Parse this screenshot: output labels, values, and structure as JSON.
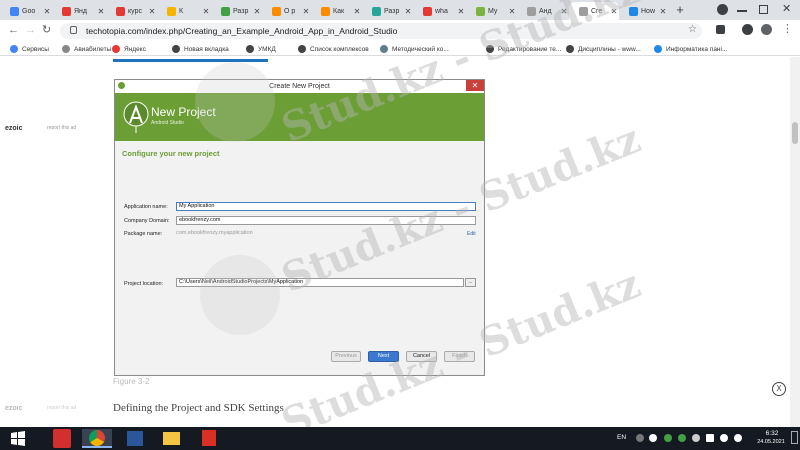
{
  "tabs": [
    {
      "label": "Goo",
      "color": "#4285f4",
      "icon": "docs-icon",
      "active": false
    },
    {
      "label": "Янд",
      "color": "#e53935",
      "icon": "yandex-icon",
      "active": false
    },
    {
      "label": "курс",
      "color": "#e53935",
      "icon": "yandex-icon",
      "active": false
    },
    {
      "label": "К",
      "color": "#f4b400",
      "icon": "folder-icon",
      "active": false
    },
    {
      "label": "Разр",
      "color": "#43a047",
      "icon": "b-icon",
      "active": false
    },
    {
      "label": "О р",
      "color": "#fb8c00",
      "icon": "site-icon",
      "active": false
    },
    {
      "label": "Как",
      "color": "#fb8c00",
      "icon": "site-icon",
      "active": false
    },
    {
      "label": "Разр",
      "color": "#26a69a",
      "icon": "android-icon",
      "active": false
    },
    {
      "label": "wha",
      "color": "#e53935",
      "icon": "yandex-icon",
      "active": false
    },
    {
      "label": "My",
      "color": "#7cb342",
      "icon": "android-icon",
      "active": false
    },
    {
      "label": "Анд",
      "color": "#9e9e9e",
      "icon": "globe-icon",
      "active": false
    },
    {
      "label": "Cre",
      "color": "#9e9e9e",
      "icon": "page-icon",
      "active": true
    },
    {
      "label": "How",
      "color": "#1e88e5",
      "icon": "site-icon",
      "active": false
    }
  ],
  "new_tab_symbol": "+",
  "url": "techotopia.com/index.php/Creating_an_Example_Android_App_in_Android_Studio",
  "bookmarks": [
    {
      "label": "Сервисы",
      "color": "#4285f4"
    },
    {
      "label": "Авиабилеты",
      "color": "#888888"
    },
    {
      "label": "Яндекс",
      "color": "#e53935"
    },
    {
      "label": "Новая вкладка",
      "color": "#444444"
    },
    {
      "label": "УМКД",
      "color": "#444444"
    },
    {
      "label": "Список комплексов",
      "color": "#444444"
    },
    {
      "label": "Методический ко...",
      "color": "#607d8b"
    },
    {
      "label": "Редактирование те...",
      "color": "#444444"
    },
    {
      "label": "Дисциплины - www...",
      "color": "#444444"
    },
    {
      "label": "Информатика пані...",
      "color": "#1e88e5"
    }
  ],
  "ad": {
    "ezoic": "ezoic",
    "report": "report this ad"
  },
  "dialog": {
    "title": "Create New Project",
    "close": "✕",
    "header_title": "New Project",
    "header_sub": "Android Studio",
    "subtitle": "Configure your new project",
    "app_name_label": "Application name:",
    "app_name_value": "My Application",
    "domain_label": "Company Domain:",
    "domain_value": "ebookfrenzy.com",
    "package_label": "Package name:",
    "package_value": "com.ebookfrenzy.myapplication",
    "edit_link": "Edit",
    "location_label": "Project location:",
    "location_value": "C:\\Users\\Neil\\AndroidStudioProjects\\MyApplication",
    "browse": "...",
    "buttons": {
      "previous": "Previous",
      "next": "Next",
      "cancel": "Cancel",
      "finish": "Finish"
    }
  },
  "watermark": "Stud.kz - Stud.kz",
  "figure_caption": "Figure 3-2",
  "section_heading": "Defining the Project and SDK Settings",
  "ad_close": "X",
  "taskbar": {
    "lang": "EN",
    "time": "6:32",
    "date": "24.05.2021"
  }
}
